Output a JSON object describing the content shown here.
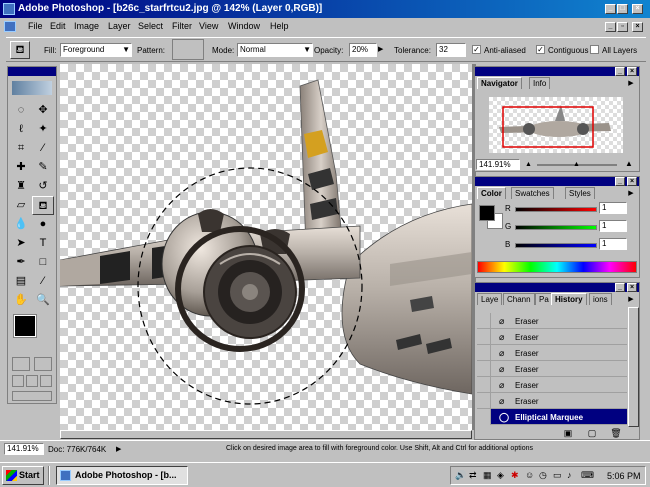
{
  "window": {
    "title": "Adobe Photoshop - [b26c_starfrtcu2.jpg @ 142% (Layer 0,RGB)]",
    "min": "_",
    "max": "□",
    "close": "×"
  },
  "menu": [
    "File",
    "Edit",
    "Image",
    "Layer",
    "Select",
    "Filter",
    "View",
    "Window",
    "Help"
  ],
  "options": {
    "fill_label": "Fill:",
    "fill_value": "Foreground",
    "pattern_label": "Pattern:",
    "mode_label": "Mode:",
    "mode_value": "Normal",
    "opacity_label": "Opacity:",
    "opacity_value": "20%",
    "tolerance_label": "Tolerance:",
    "tolerance_value": "32",
    "anti_aliased": "Anti-aliased",
    "contiguous": "Contiguous",
    "all_layers": "All Layers"
  },
  "navigator": {
    "tabs": [
      "Navigator",
      "Info"
    ],
    "zoom": "141.91%"
  },
  "color": {
    "tabs": [
      "Color",
      "Swatches",
      "Styles"
    ],
    "r_label": "R",
    "r_value": "1",
    "g_label": "G",
    "g_value": "1",
    "b_label": "B",
    "b_value": "1"
  },
  "history": {
    "tabs": [
      "Laye",
      "Chann",
      "Pa",
      "History",
      "ions"
    ],
    "items": [
      "Eraser",
      "Eraser",
      "Eraser",
      "Eraser",
      "Eraser",
      "Eraser"
    ],
    "selected": "Elliptical Marquee"
  },
  "status": {
    "zoom": "141.91%",
    "doc": "Doc: 776K/764K",
    "hint": "Click on desired image area to fill with foreground color.  Use Shift, Alt and Ctrl for additional options"
  },
  "taskbar": {
    "start": "Start",
    "task": "Adobe Photoshop - [b...",
    "time": "5:06 PM"
  },
  "colors": {
    "titlebar": "#000080",
    "selection": "#000080"
  }
}
